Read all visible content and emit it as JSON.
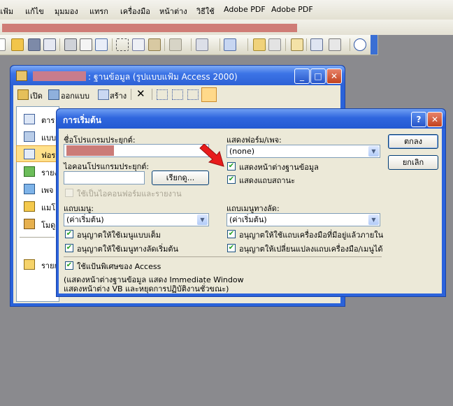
{
  "menubar": {
    "items": [
      "แฟ้ม",
      "แก้ไข",
      "มุมมอง",
      "แทรก",
      "เครื่องมือ",
      "หน้าต่าง",
      "วิธีใช้",
      "Adobe PDF",
      "Adobe PDF"
    ]
  },
  "toolbar": {
    "icons": [
      "new-icon",
      "open-icon",
      "save-icon",
      "search-file-icon",
      "print-icon",
      "print-preview-icon",
      "spelling-icon",
      "cut-icon",
      "copy-icon",
      "paste-icon",
      "undo-icon",
      "office-links-icon",
      "analyze-icon",
      "code-icon",
      "properties-icon",
      "relationships-icon",
      "new-object-icon",
      "help-icon"
    ]
  },
  "db_window": {
    "title_suffix": ": ฐานข้อมูล (รูปแบบแฟ้ม Access 2000)",
    "toolbar": {
      "open": "เปิด",
      "design": "ออกแบบ",
      "create": "สร้าง"
    },
    "sidebar": [
      {
        "label": "ตาร",
        "icon": "tables-icon"
      },
      {
        "label": "แบบ",
        "icon": "queries-icon"
      },
      {
        "label": "ฟอร",
        "icon": "forms-icon"
      },
      {
        "label": "รายง",
        "icon": "reports-icon"
      },
      {
        "label": "เพจ",
        "icon": "pages-icon"
      },
      {
        "label": "แมโ",
        "icon": "macros-icon"
      },
      {
        "label": "โมดู",
        "icon": "modules-icon"
      },
      {
        "label": "รายก",
        "icon": "favorites-icon"
      }
    ]
  },
  "dialog": {
    "title": "การเริ่มต้น",
    "app_title_label": "ชื่อโปรแกรมประยุกต์:",
    "app_icon_label": "ไอคอนโปรแกรมประยุกต์:",
    "browse": "เรียกดู...",
    "use_icon_label": "ใช้เป็นไอคอนฟอร์มและรายงาน",
    "display_form_label": "แสดงฟอร์ม/เพจ:",
    "display_form_value": "(none)",
    "show_db_window": "แสดงหน้าต่างฐานข้อมูล",
    "show_status_bar": "แสดงแถบสถานะ",
    "menu_bar_label": "แถบเมนู:",
    "menu_bar_value": "(ค่าเริ่มต้น)",
    "shortcut_menu_label": "แถบเมนูทางลัด:",
    "shortcut_menu_value": "(ค่าเริ่มต้น)",
    "allow_full_menus": "อนุญาตให้ใช้เมนูแบบเต็ม",
    "allow_default_shortcut": "อนุญาตให้ใช้เมนูทางลัดเริ่มต้น",
    "allow_builtin_toolbars": "อนุญาตให้ใช้แถบเครื่องมือที่มีอยู่แล้วภายใน",
    "allow_toolbar_changes": "อนุญาตให้เปลี่ยนแปลงแถบเครื่องมือ/เมนูได้",
    "use_special_keys": "ใช้แป้นพิเศษของ Access",
    "special_keys_note_1": "(แสดงหน้าต่างฐานข้อมูล แสดง Immediate Window",
    "special_keys_note_2": "แสดงหน้าต่าง VB และหยุดการปฏิบัติงานชั่วขณะ)",
    "ok": "ตกลง",
    "cancel": "ยกเลิก",
    "help_glyph": "?",
    "close_glyph": "✕"
  },
  "colors": {
    "xp_blue": "#2c63dc",
    "dialog_face": "#ece9d8",
    "redaction": "#cb7b78",
    "arrow_red": "#e81c1c"
  }
}
